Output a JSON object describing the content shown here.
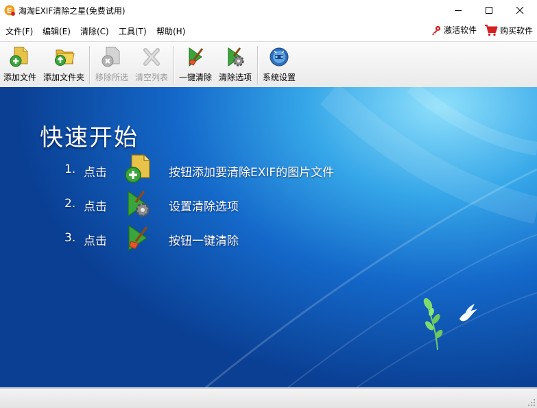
{
  "window": {
    "title": "淘淘EXIF清除之星(免费试用)"
  },
  "menu": {
    "items": [
      "文件(F)",
      "编辑(E)",
      "清除(C)",
      "工具(T)",
      "帮助(H)"
    ],
    "activate_label": "激活软件",
    "buy_label": "购买软件"
  },
  "toolbar": {
    "add_file": "添加文件",
    "add_folder": "添加文件夹",
    "remove_selected": "移除所选",
    "clear_list": "清空列表",
    "one_click_clean": "一键清除",
    "clean_options": "清除选项",
    "system_settings": "系统设置"
  },
  "quick_start": {
    "title": "快速开始",
    "steps": [
      {
        "num": "1.",
        "click": "点击",
        "text": "按钮添加要清除EXIF的图片文件"
      },
      {
        "num": "2.",
        "click": "点击",
        "text": "设置清除选项"
      },
      {
        "num": "3.",
        "click": "点击",
        "text": "按钮一键清除"
      }
    ]
  },
  "colors": {
    "accent_green": "#3aa53a",
    "bg_blue_dark": "#0a3f93",
    "bg_blue_light": "#8fe0fb",
    "cart_red": "#d42020"
  }
}
